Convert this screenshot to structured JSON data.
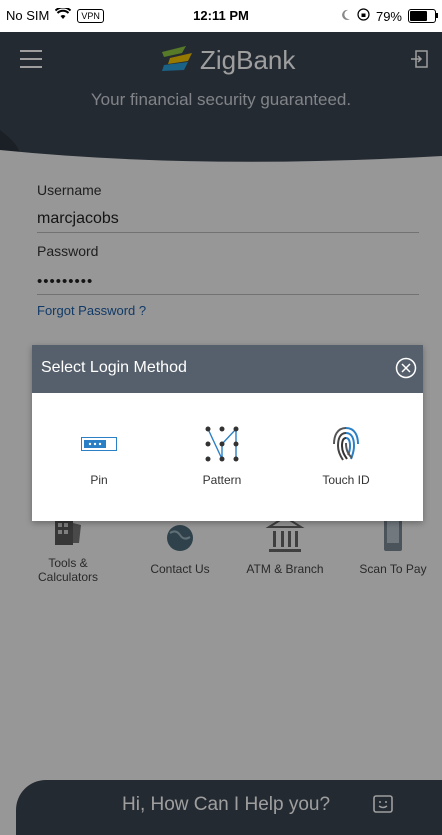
{
  "status_bar": {
    "carrier": "No SIM",
    "vpn": "VPN",
    "time": "12:11 PM",
    "battery": "79%",
    "battery_level_percent": 79
  },
  "header": {
    "brand": "ZigBank",
    "tagline": "Your financial security guaranteed.",
    "menu_icon": "hamburger-icon",
    "logout_icon": "logout-icon"
  },
  "login_form": {
    "username_label": "Username",
    "username_value": "marcjacobs",
    "password_label": "Password",
    "password_value": "•••••••••",
    "forgot_password": "Forgot Password ?"
  },
  "quick_links": [
    {
      "label": "Tools & Calculators",
      "icon": "calculator-icon"
    },
    {
      "label": "Contact Us",
      "icon": "globe-icon"
    },
    {
      "label": "ATM & Branch",
      "icon": "bank-icon"
    },
    {
      "label": "Scan To Pay",
      "icon": "phone-scan-icon"
    }
  ],
  "login_method_modal": {
    "title": "Select Login Method",
    "close_icon": "close-circle-icon",
    "methods": [
      {
        "label": "Pin",
        "icon": "pin-icon"
      },
      {
        "label": "Pattern",
        "icon": "pattern-icon"
      },
      {
        "label": "Touch ID",
        "icon": "fingerprint-icon"
      }
    ]
  },
  "chat": {
    "prompt": "Hi, How Can I Help you?",
    "icon": "chat-smile-icon"
  },
  "colors": {
    "header_bg": "#3b4552",
    "modal_header_bg": "#56606c",
    "link": "#1e5ea6",
    "logo_green": "#8cc63f",
    "logo_blue": "#2b9fd8"
  }
}
